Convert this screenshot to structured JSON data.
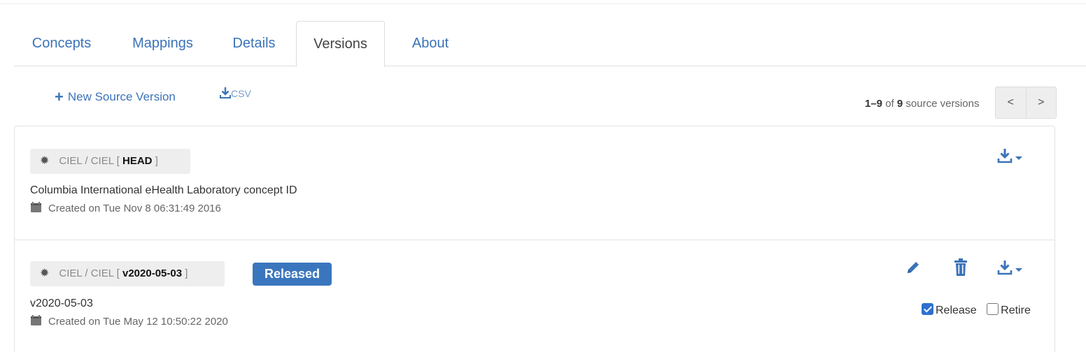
{
  "tabs": [
    {
      "label": "Concepts",
      "active": false
    },
    {
      "label": "Mappings",
      "active": false
    },
    {
      "label": "Details",
      "active": false
    },
    {
      "label": "Versions",
      "active": true
    },
    {
      "label": "About",
      "active": false
    }
  ],
  "toolbar": {
    "new_version_label": "New Source Version",
    "csv_label": "CSV"
  },
  "pager": {
    "range": "1–9",
    "of": "of",
    "total": "9",
    "suffix": "source versions",
    "prev": "<",
    "next": ">"
  },
  "versions": [
    {
      "label_prefix": "CIEL / CIEL [",
      "version": "HEAD",
      "label_suffix": "]",
      "description": "Columbia International eHealth Laboratory concept ID",
      "created": "Created on Tue Nov 8 06:31:49 2016"
    },
    {
      "label_prefix": "CIEL / CIEL [",
      "version": "v2020-05-03",
      "label_suffix": "]",
      "badge": "Released",
      "description": "v2020-05-03",
      "created": "Created on Tue May 12 10:50:22 2020",
      "release_label": "Release",
      "release_checked": true,
      "retire_label": "Retire",
      "retire_checked": false
    }
  ],
  "colors": {
    "link": "#3b73b9",
    "badge": "#3a76bd"
  }
}
